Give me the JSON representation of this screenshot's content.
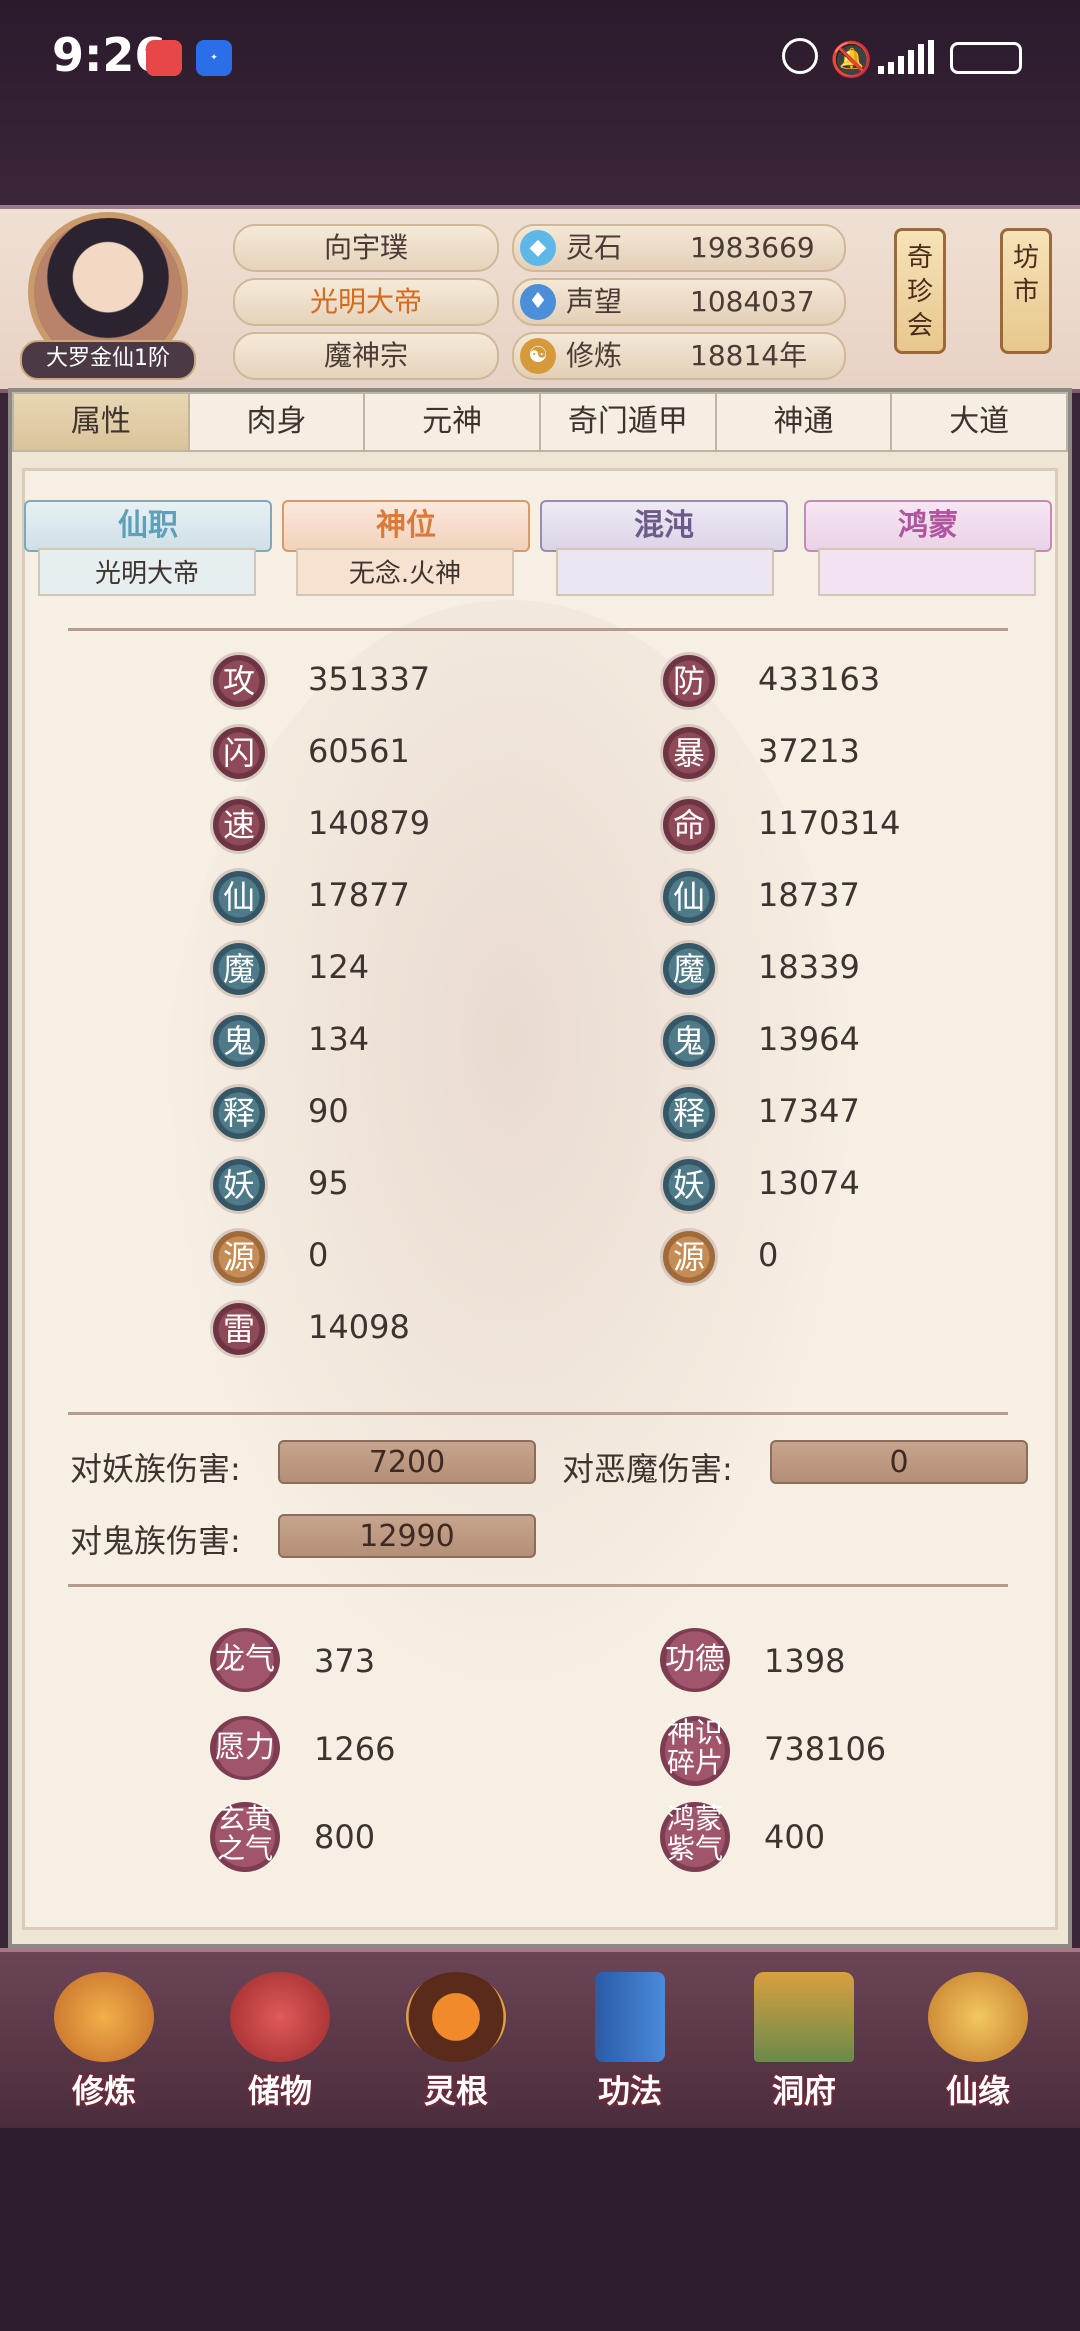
{
  "status_bar": {
    "time": "9:26"
  },
  "header": {
    "rank": "大罗金仙1阶",
    "name": "向宇璞",
    "title": "光明大帝",
    "sect": "魔神宗",
    "resources": [
      {
        "icon": "spirit-stone-icon",
        "label": "灵石",
        "value": "1983669"
      },
      {
        "icon": "prestige-icon",
        "label": "声望",
        "value": "1084037"
      },
      {
        "icon": "cultivation-icon",
        "label": "修炼",
        "value": "18814年"
      }
    ],
    "side_buttons": [
      "奇珍会",
      "坊市"
    ]
  },
  "tabs": [
    "属性",
    "肉身",
    "元神",
    "奇门遁甲",
    "神通",
    "大道"
  ],
  "ribbons": [
    {
      "label": "仙职",
      "value": "光明大帝",
      "color": "#5f9fb8"
    },
    {
      "label": "神位",
      "value": "无念.火神",
      "color": "#d97a3a"
    },
    {
      "label": "混沌",
      "value": "",
      "color": "#6b5a8a"
    },
    {
      "label": "鸿蒙",
      "value": "",
      "color": "#b056a0"
    }
  ],
  "stats_left": [
    {
      "char": "攻",
      "value": "351337"
    },
    {
      "char": "闪",
      "value": "60561"
    },
    {
      "char": "速",
      "value": "140879"
    },
    {
      "char": "仙",
      "value": "17877"
    },
    {
      "char": "魔",
      "value": "124"
    },
    {
      "char": "鬼",
      "value": "134"
    },
    {
      "char": "释",
      "value": "90"
    },
    {
      "char": "妖",
      "value": "95"
    },
    {
      "char": "源",
      "value": "0"
    },
    {
      "char": "雷",
      "value": "14098"
    }
  ],
  "stats_right": [
    {
      "char": "防",
      "value": "433163"
    },
    {
      "char": "暴",
      "value": "37213"
    },
    {
      "char": "命",
      "value": "1170314"
    },
    {
      "char": "仙",
      "value": "18737"
    },
    {
      "char": "魔",
      "value": "18339"
    },
    {
      "char": "鬼",
      "value": "13964"
    },
    {
      "char": "释",
      "value": "17347"
    },
    {
      "char": "妖",
      "value": "13074"
    },
    {
      "char": "源",
      "value": "0"
    }
  ],
  "damage": [
    {
      "label": "对妖族伤害:",
      "value": "7200"
    },
    {
      "label": "对恶魔伤害:",
      "value": "0"
    },
    {
      "label": "对鬼族伤害:",
      "value": "12990"
    }
  ],
  "misc": [
    {
      "label": "龙气",
      "value": "373"
    },
    {
      "label": "功德",
      "value": "1398"
    },
    {
      "label": "愿力",
      "value": "1266"
    },
    {
      "label": "神识碎片",
      "value": "738106"
    },
    {
      "label": "玄黄之气",
      "value": "800"
    },
    {
      "label": "鸿蒙紫气",
      "value": "400"
    }
  ],
  "bottom_nav": [
    "修炼",
    "储物",
    "灵根",
    "功法",
    "洞府",
    "仙缘"
  ]
}
